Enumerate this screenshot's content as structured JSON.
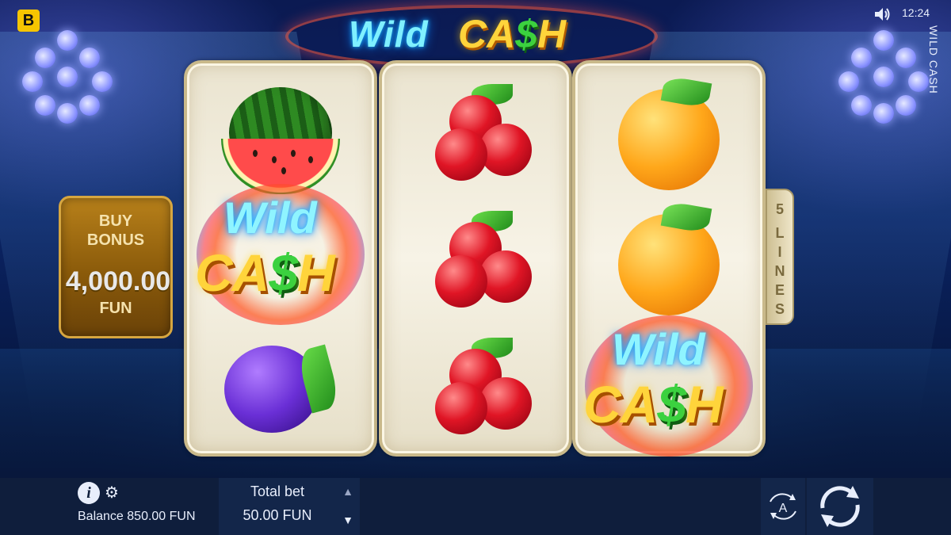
{
  "top_bar": {
    "brand_letter": "B",
    "time": "12:24",
    "game_name": "WILD CASH",
    "sound_icon": "speaker-icon"
  },
  "logo": {
    "word_1": "Wild",
    "word_2_before": "CA",
    "word_2_dollar": "$",
    "word_2_after": "H"
  },
  "buy_bonus": {
    "line_1": "BUY",
    "line_2": "BONUS",
    "amount": "4,000.00",
    "currency": "FUN"
  },
  "lines_tab": {
    "count": "5",
    "letters": [
      "L",
      "I",
      "N",
      "E",
      "S"
    ]
  },
  "reels": [
    [
      "watermelon",
      "wild-cash",
      "plum"
    ],
    [
      "cherries",
      "cherries",
      "cherries"
    ],
    [
      "orange",
      "orange",
      "wild-cash"
    ]
  ],
  "wild_symbol": {
    "top": "Wild",
    "bottom_before": "CA",
    "dollar": "$",
    "bottom_after": "H"
  },
  "bottom_bar": {
    "info_icon": "info-icon",
    "settings_icon": "gear-icon",
    "balance": "Balance 850.00 FUN",
    "total_bet_label": "Total bet",
    "total_bet_value": "50.00 FUN",
    "autoplay_letter": "A"
  },
  "colors": {
    "background_top": "#0b1a52",
    "reel_frame": "#c9b98a",
    "bottom_bar": "#0f1e3c",
    "buy_bonus": "#8a5a0a",
    "brand": "#f6c500"
  }
}
